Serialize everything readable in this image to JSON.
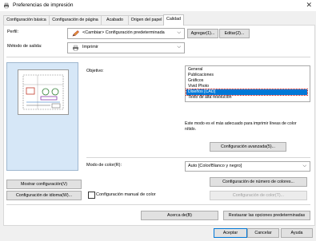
{
  "window": {
    "title": "Preferencias de impresión",
    "close_glyph": "✕"
  },
  "tabs": [
    {
      "label": "Configuración básica"
    },
    {
      "label": "Configuración de página"
    },
    {
      "label": "Acabado"
    },
    {
      "label": "Origen del papel"
    },
    {
      "label": "Calidad"
    }
  ],
  "active_tab": "Calidad",
  "profile": {
    "label": "Perfil:",
    "value": "<Cambiar> Configuración predeterminada",
    "icon": "pencil-icon",
    "add_button": "Agregar(1)...",
    "edit_button": "Editar(2)..."
  },
  "output": {
    "label": "Método de salida:",
    "value": "Imprimir",
    "icon": "printer-icon"
  },
  "objective": {
    "label": "Objetivo:",
    "items": [
      "General",
      "Publicaciones",
      "Gráficos",
      "Vivid Photo",
      "Diseños [CAD]",
      "Texto de alta resolución"
    ],
    "selected_index": 4,
    "description": "Este modo es el más adecuado para imprimir líneas de color nítido.",
    "advanced_button": "Configuración avanzada(5)..."
  },
  "color_mode": {
    "label": "Modo de color(R):",
    "value": "Auto [Color/Blanco y negro]",
    "color_count_button": "Configuración de número de colores...",
    "color_settings_button": "Configuración de color(T)..."
  },
  "left_panel": {
    "show_config_button": "Mostrar configuración(V)",
    "language_button": "Configuración de idioma(W)...",
    "manual_color_checkbox": "Configuración manual de color",
    "manual_color_checked": false
  },
  "bottom": {
    "about_button": "Acerca de(B)",
    "restore_button": "Restaurar las opciones predeterminadas"
  },
  "dialog_buttons": {
    "ok": "Aceptar",
    "cancel": "Cancelar",
    "help": "Ayuda"
  },
  "colors": {
    "accent": "#0078d7",
    "preview_bg": "#d6e7f7"
  }
}
